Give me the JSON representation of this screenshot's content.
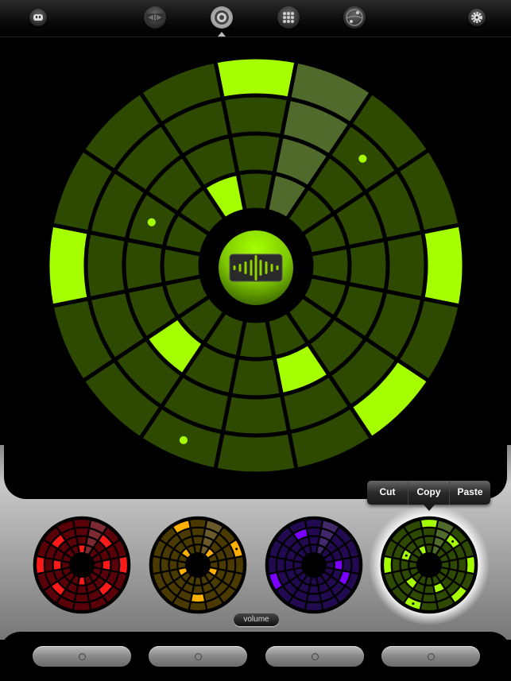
{
  "toolbar": {
    "items": [
      {
        "icon": "robot-icon",
        "active": false
      },
      {
        "icon": "waveform-icon",
        "active": false
      },
      {
        "icon": "wheel-icon",
        "active": true
      },
      {
        "icon": "grid-icon",
        "active": false
      },
      {
        "icon": "mixer-icon",
        "active": false
      },
      {
        "icon": "gear-icon",
        "active": false
      }
    ]
  },
  "main_wheel": {
    "color": "#2e4a00",
    "lit_color": "#a6ff00",
    "playhead_color": "#4f6a2a",
    "rings": 4,
    "steps": 16,
    "playhead_step": 1,
    "lit": [
      [
        3,
        0
      ],
      [
        3,
        4
      ],
      [
        3,
        12
      ],
      [
        3,
        6
      ],
      [
        1,
        10
      ],
      [
        1,
        7
      ],
      [
        0,
        15
      ]
    ],
    "dots": [
      [
        2,
        2
      ],
      [
        1,
        13
      ],
      [
        3,
        9
      ]
    ],
    "center_icon": "waveform-icon"
  },
  "context_menu": {
    "cut": "Cut",
    "copy": "Copy",
    "paste": "Paste"
  },
  "mini_wheels": [
    {
      "color": "#5a0008",
      "lit_color": "#ff1a1a",
      "playhead_color": "#7a2a30",
      "selected": false,
      "lit": [
        [
          3,
          4
        ],
        [
          3,
          12
        ],
        [
          2,
          2
        ],
        [
          2,
          6
        ],
        [
          2,
          10
        ],
        [
          2,
          14
        ],
        [
          1,
          4
        ],
        [
          1,
          12
        ],
        [
          0,
          0
        ],
        [
          0,
          8
        ]
      ],
      "dots": []
    },
    {
      "color": "#4a3a00",
      "lit_color": "#ffb000",
      "playhead_color": "#6a5a2a",
      "selected": false,
      "lit": [
        [
          3,
          15
        ],
        [
          3,
          3
        ],
        [
          2,
          8
        ],
        [
          0,
          14
        ],
        [
          0,
          2
        ],
        [
          0,
          5
        ],
        [
          0,
          11
        ]
      ],
      "dots": [
        [
          3,
          3
        ]
      ]
    },
    {
      "color": "#220a50",
      "lit_color": "#7a00ff",
      "playhead_color": "#40286a",
      "selected": false,
      "lit": [
        [
          2,
          15
        ],
        [
          1,
          4
        ],
        [
          2,
          5
        ],
        [
          3,
          11
        ]
      ],
      "dots": []
    },
    {
      "color": "#2e4a00",
      "lit_color": "#a6ff00",
      "playhead_color": "#4f6a2a",
      "selected": true,
      "lit": [
        [
          3,
          0
        ],
        [
          3,
          4
        ],
        [
          3,
          12
        ],
        [
          3,
          6
        ],
        [
          1,
          10
        ],
        [
          1,
          7
        ],
        [
          0,
          15
        ],
        [
          2,
          2
        ],
        [
          1,
          13
        ],
        [
          3,
          9
        ]
      ],
      "dots": [
        [
          2,
          2
        ],
        [
          1,
          13
        ],
        [
          3,
          9
        ]
      ]
    }
  ],
  "volume_label": "volume",
  "bottom_buttons": [
    "track-1",
    "track-2",
    "track-3",
    "track-4"
  ]
}
